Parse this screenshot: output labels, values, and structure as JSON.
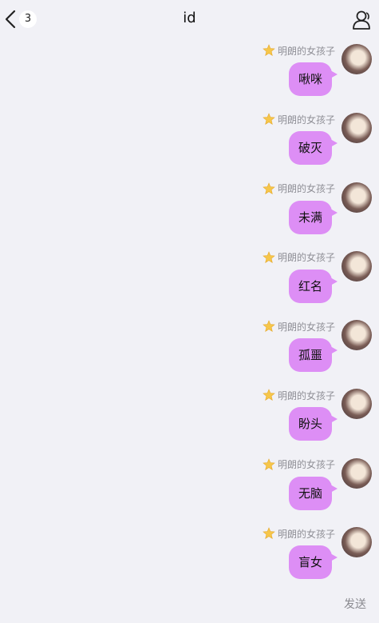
{
  "header": {
    "back_badge": "3",
    "title": "id"
  },
  "messages": [
    {
      "nickname": "明朗的女孩子",
      "text": "啾咪"
    },
    {
      "nickname": "明朗的女孩子",
      "text": "破灭"
    },
    {
      "nickname": "明朗的女孩子",
      "text": "未满"
    },
    {
      "nickname": "明朗的女孩子",
      "text": "红名"
    },
    {
      "nickname": "明朗的女孩子",
      "text": "孤噩"
    },
    {
      "nickname": "明朗的女孩子",
      "text": "盼头"
    },
    {
      "nickname": "明朗的女孩子",
      "text": "无脑"
    },
    {
      "nickname": "明朗的女孩子",
      "text": "盲女"
    }
  ],
  "footer": {
    "send_label": "发送"
  },
  "colors": {
    "bubble": "#dd8ef5",
    "background": "#f1f1f6",
    "star": "#f6c64a"
  },
  "icons": {
    "back": "chevron-left-icon",
    "profile": "user-profile-icon",
    "rank": "star-icon"
  }
}
